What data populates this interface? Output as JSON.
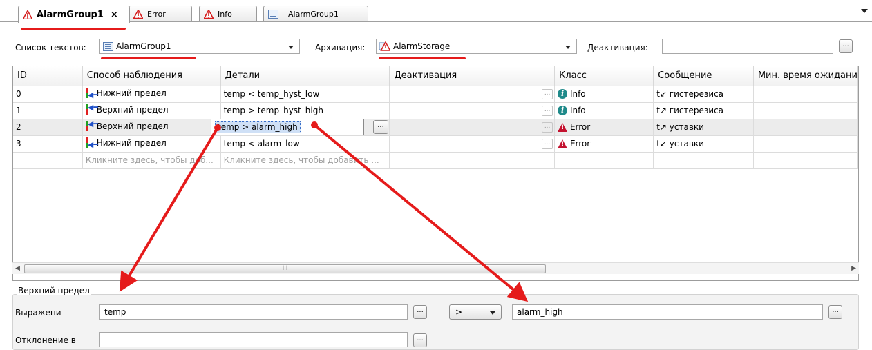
{
  "tabs": [
    {
      "label": "AlarmGroup1",
      "close": "×",
      "icon": "warning-icon"
    },
    {
      "label": "Error",
      "icon": "warning-icon"
    },
    {
      "label": "Info",
      "icon": "warning-icon"
    },
    {
      "label": "AlarmGroup1",
      "icon": "list-icon"
    }
  ],
  "form": {
    "text_list_label": "Список текстов:",
    "text_list_value": "AlarmGroup1",
    "archive_label": "Архивация:",
    "archive_value": "AlarmStorage",
    "deactivation_label": "Деактивация:",
    "deactivation_value": "",
    "browse_label": "..."
  },
  "grid": {
    "columns": [
      "ID",
      "Способ наблюдения",
      "Детали",
      "Деактивация",
      "Класс",
      "Сообщение",
      "Мин. время ожидани"
    ],
    "rows": [
      {
        "id": "0",
        "method": "Нижний предел",
        "details": "temp < temp_hyst_low",
        "class": "Info",
        "message": "t↙ гистерезиса"
      },
      {
        "id": "1",
        "method": "Верхний предел",
        "details": "temp > temp_hyst_high",
        "class": "Info",
        "message": "t↗ гистерезиса"
      },
      {
        "id": "2",
        "method": "Верхний предел",
        "details": "temp > alarm_high",
        "class": "Error",
        "message": "t↗ уставки"
      },
      {
        "id": "3",
        "method": "Нижний предел",
        "details": "temp < alarm_low",
        "class": "Error",
        "message": "t↙ уставки"
      }
    ],
    "new_row_method": "Кликните здесь, чтобы доб...",
    "new_row_details": "Кликните здесь, чтобы добавить ...",
    "editor_value": "temp > alarm_high",
    "cell_button": "...",
    "scroll_grip": "III",
    "scroll_left": "◀",
    "scroll_right": "▶"
  },
  "detail": {
    "group_title": "Верхний предел",
    "expression_label": "Выражени",
    "expression_value": "temp",
    "operator": ">",
    "limit_value": "alarm_high",
    "deviation_label": "Отклонение в",
    "deviation_value": "",
    "browse_label": "..."
  },
  "colors": {
    "annotation_red": "#e51b1b",
    "info_teal": "#1f8a8a",
    "error_red": "#c4122f",
    "selection_blue": "#cfe0f6"
  }
}
